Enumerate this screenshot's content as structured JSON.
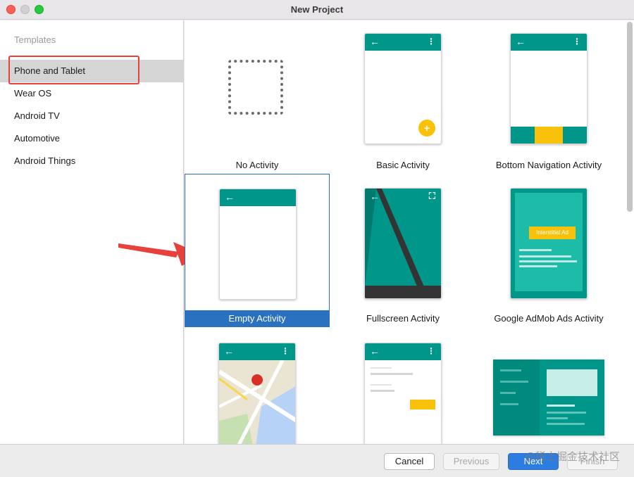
{
  "window": {
    "title": "New Project"
  },
  "sidebar": {
    "header": "Templates",
    "items": [
      {
        "label": "Phone and Tablet",
        "selected": true
      },
      {
        "label": "Wear OS"
      },
      {
        "label": "Android TV"
      },
      {
        "label": "Automotive"
      },
      {
        "label": "Android Things"
      }
    ]
  },
  "templates": [
    {
      "label": "No Activity"
    },
    {
      "label": "Basic Activity"
    },
    {
      "label": "Bottom Navigation Activity"
    },
    {
      "label": "Empty Activity",
      "selected": true
    },
    {
      "label": "Fullscreen Activity"
    },
    {
      "label": "Google AdMob Ads Activity",
      "ad_text": "Interstitial Ad"
    }
  ],
  "buttons": {
    "cancel": "Cancel",
    "previous": "Previous",
    "next": "Next",
    "finish": "Finish"
  },
  "watermark": "@稀土掘金技术社区",
  "colors": {
    "teal": "#00968a",
    "accent": "#f9c10a",
    "selection": "#2a71c0",
    "annotation": "#e8403a"
  }
}
